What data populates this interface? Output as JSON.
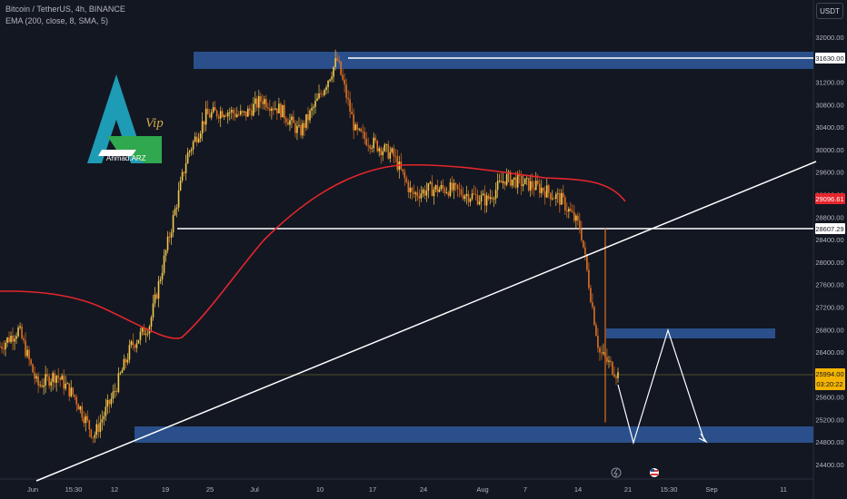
{
  "header": {
    "symbol_line": "Bitcoin / TetherUS, 4h, BINANCE",
    "indicator_line": "EMA (200, close, 8, SMA, 5)",
    "currency_button": "USDT"
  },
  "logo": {
    "brand_text": "Ahmad.ARZ",
    "tag": "Vip"
  },
  "colors": {
    "background": "#131722",
    "up_candle": "#f2c94c",
    "down_candle": "#e07020",
    "ema": "#e5262c",
    "zone": "#2a4f8a",
    "trendline": "#ffffff",
    "price_marker": "#f5b400",
    "ema_marker": "#e5262c",
    "projection": "#ffffff"
  },
  "chart_data": {
    "type": "candlestick",
    "symbol": "BTCUSDT",
    "timeframe": "4h",
    "exchange": "BINANCE",
    "ylim": [
      24000,
      32350
    ],
    "y_ticks": [
      "24400.00",
      "24800.00",
      "25200.00",
      "25600.00",
      "26000.00",
      "26400.00",
      "26800.00",
      "27200.00",
      "27600.00",
      "28000.00",
      "28400.00",
      "28800.00",
      "29200.00",
      "29600.00",
      "30000.00",
      "30400.00",
      "30800.00",
      "31200.00",
      "31600.00",
      "32000.00"
    ],
    "x_ticks": [
      "Jun",
      "15:30",
      "12",
      "19",
      "25",
      "Jul",
      "10",
      "17",
      "24",
      "Aug",
      "7",
      "14",
      "21",
      "15:30",
      "Sep",
      "11"
    ],
    "price_series": [
      {
        "date": "Jun 6",
        "close": 26500
      },
      {
        "date": "Jun 8",
        "close": 26800
      },
      {
        "date": "Jun 10",
        "close": 25800
      },
      {
        "date": "Jun 12",
        "close": 26000
      },
      {
        "date": "Jun 14",
        "close": 25600
      },
      {
        "date": "Jun 15",
        "close": 24900
      },
      {
        "date": "Jun 16",
        "close": 25600
      },
      {
        "date": "Jun 18",
        "close": 26500
      },
      {
        "date": "Jun 20",
        "close": 26900
      },
      {
        "date": "Jun 21",
        "close": 28400
      },
      {
        "date": "Jun 22",
        "close": 29900
      },
      {
        "date": "Jun 24",
        "close": 30600
      },
      {
        "date": "Jun 27",
        "close": 30700
      },
      {
        "date": "Jun 30",
        "close": 30600
      },
      {
        "date": "Jul 3",
        "close": 30900
      },
      {
        "date": "Jul 6",
        "close": 30700
      },
      {
        "date": "Jul 9",
        "close": 30300
      },
      {
        "date": "Jul 13",
        "close": 30900
      },
      {
        "date": "Jul 14",
        "close": 31600
      },
      {
        "date": "Jul 16",
        "close": 30300
      },
      {
        "date": "Jul 19",
        "close": 30100
      },
      {
        "date": "Jul 22",
        "close": 29900
      },
      {
        "date": "Jul 24",
        "close": 29200
      },
      {
        "date": "Jul 27",
        "close": 29300
      },
      {
        "date": "Jul 30",
        "close": 29300
      },
      {
        "date": "Aug 2",
        "close": 29200
      },
      {
        "date": "Aug 5",
        "close": 29100
      },
      {
        "date": "Aug 8",
        "close": 29500
      },
      {
        "date": "Aug 11",
        "close": 29400
      },
      {
        "date": "Aug 14",
        "close": 29300
      },
      {
        "date": "Aug 15",
        "close": 29100
      },
      {
        "date": "Aug 16",
        "close": 28600
      },
      {
        "date": "Aug 17",
        "close": 26400
      },
      {
        "date": "Aug 18",
        "close": 26000
      }
    ],
    "ema_series": [
      {
        "date": "Jun 6",
        "value": 27500
      },
      {
        "date": "Jun 12",
        "value": 27300
      },
      {
        "date": "Jun 18",
        "value": 26700
      },
      {
        "date": "Jun 22",
        "value": 26900
      },
      {
        "date": "Jun 25",
        "value": 27700
      },
      {
        "date": "Jul 1",
        "value": 28600
      },
      {
        "date": "Jul 8",
        "value": 29200
      },
      {
        "date": "Jul 14",
        "value": 29600
      },
      {
        "date": "Jul 24",
        "value": 29750
      },
      {
        "date": "Aug 3",
        "value": 29600
      },
      {
        "date": "Aug 12",
        "value": 29500
      },
      {
        "date": "Aug 16",
        "value": 29200
      }
    ],
    "zones": [
      {
        "label": "resistance",
        "from": 31500,
        "to": 31800
      },
      {
        "label": "resistance",
        "from": 26750,
        "to": 26900
      },
      {
        "label": "support",
        "from": 24850,
        "to": 25150
      }
    ],
    "lines": [
      {
        "type": "horizontal",
        "value": 31630
      },
      {
        "type": "horizontal",
        "value": 28607.29
      }
    ],
    "price_labels": {
      "level_1": "31630.00",
      "ema_value": "29096.61",
      "level_2": "28607.29",
      "last_price": "25994.00",
      "countdown": "03:20:22"
    },
    "projection_path": [
      26300,
      24850,
      26850,
      24900
    ],
    "grid": false
  }
}
